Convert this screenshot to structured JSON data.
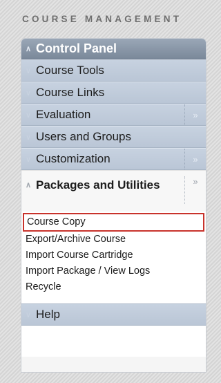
{
  "heading": "COURSE MANAGEMENT",
  "control_panel": {
    "icon": "chevron-up-icon",
    "label": "Control Panel"
  },
  "sections": [
    {
      "label": "Course Tools",
      "has_arrow": false
    },
    {
      "label": "Course Links",
      "has_arrow": false
    },
    {
      "label": "Evaluation",
      "has_arrow": true
    },
    {
      "label": "Users and Groups",
      "has_arrow": false
    },
    {
      "label": "Customization",
      "has_arrow": true
    }
  ],
  "expanded_section": {
    "label": "Packages and Utilities",
    "items": [
      "Course Copy",
      "Export/Archive Course",
      "Import Course Cartridge",
      "Import Package / View Logs",
      "Recycle"
    ],
    "selected_item": "Course Copy"
  },
  "help": {
    "label": "Help"
  },
  "glyphs": {
    "chevron_down": "∨",
    "chevron_up": "∧",
    "arrow_right": "»"
  },
  "colors": {
    "header_bg": "#8694a6",
    "row_bg": "#c1ccdb",
    "selection_border": "#c8322b"
  }
}
